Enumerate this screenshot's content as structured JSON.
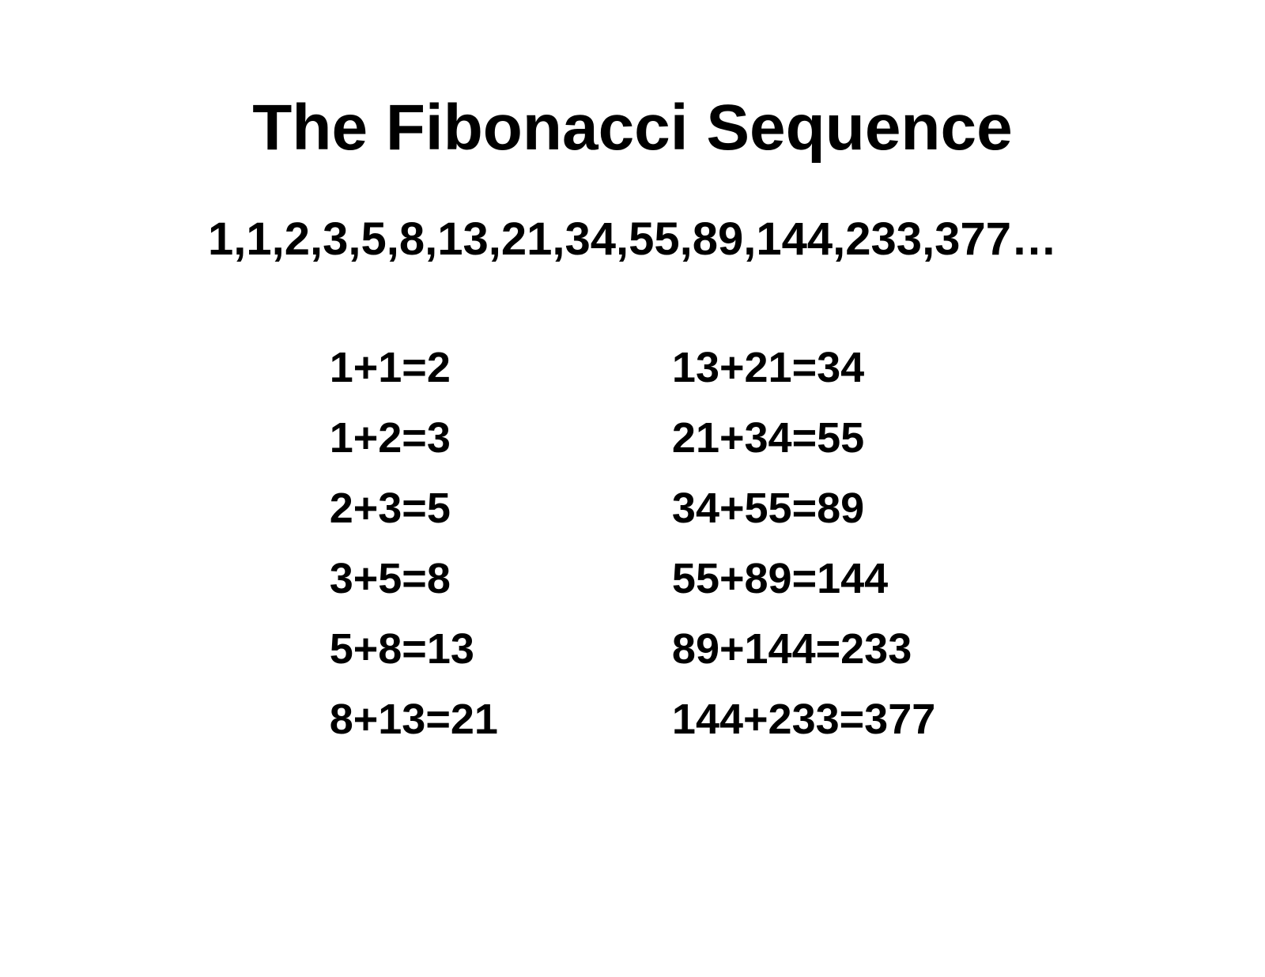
{
  "title": "The Fibonacci Sequence",
  "sequence": "1,1,2,3,5,8,13,21,34,55,89,144,233,377…",
  "left_column": [
    "1+1=2",
    "1+2=3",
    "2+3=5",
    "3+5=8",
    "5+8=13",
    "8+13=21"
  ],
  "right_column": [
    "13+21=34",
    "21+34=55",
    "34+55=89",
    "55+89=144",
    "89+144=233",
    "144+233=377"
  ]
}
